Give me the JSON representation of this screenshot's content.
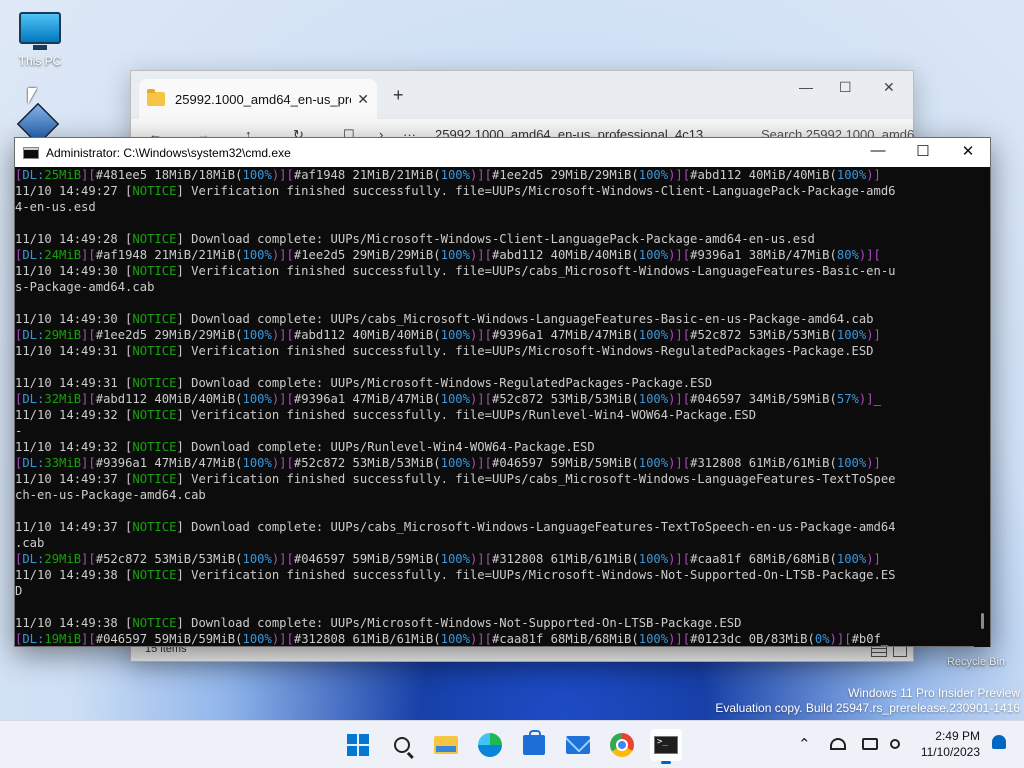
{
  "desktop": {
    "icons": [
      {
        "label": "This PC",
        "icon": "computer-icon"
      },
      {
        "label": "",
        "icon": "virtualbox-icon"
      },
      {
        "label": "Recycle Bin",
        "icon": "recycle-bin-icon"
      }
    ]
  },
  "explorer": {
    "tab_title": "25992.1000_amd64_en-us_pro",
    "tab_close": "✕",
    "new_tab": "+",
    "minimize": "—",
    "maximize": "☐",
    "close": "✕",
    "nav": {
      "back": "←",
      "forward": "→",
      "up": "↑",
      "refresh": "↻",
      "view": "☐",
      "chevron": "›",
      "more": "···"
    },
    "address": "25992.1000_amd64_en-us_professional_4c13...",
    "search_placeholder": "Search 25992.1000_amd6",
    "status": "15 items"
  },
  "cmd": {
    "title": "Administrator: C:\\Windows\\system32\\cmd.exe",
    "minimize": "—",
    "maximize": "☐",
    "close": "✕",
    "colors": {
      "magenta": "#b148c6",
      "cyan": "#3a96dd",
      "green": "#13a10e",
      "text": "#cccccc",
      "background": "#0c0c0c"
    },
    "lines": [
      [
        [
          "[",
          "m"
        ],
        [
          "DL:",
          "c"
        ],
        [
          "25MiB",
          "g"
        ],
        [
          "][",
          "m"
        ],
        [
          "#481ee5 18MiB/18MiB(",
          ""
        ],
        [
          "100%",
          "c"
        ],
        [
          ")][",
          "m"
        ],
        [
          "#af1948 21MiB/21MiB(",
          ""
        ],
        [
          "100%",
          "c"
        ],
        [
          ")][",
          "m"
        ],
        [
          "#1ee2d5 29MiB/29MiB(",
          ""
        ],
        [
          "100%",
          "c"
        ],
        [
          ")][",
          "m"
        ],
        [
          "#abd112 40MiB/40MiB(",
          ""
        ],
        [
          "100%",
          "c"
        ],
        [
          ")]",
          "m"
        ]
      ],
      [
        [
          "11/10 14:49:27 [",
          ""
        ],
        [
          "NOTICE",
          "g"
        ],
        [
          "] Verification finished successfully. file=UUPs/Microsoft-Windows-Client-LanguagePack-Package-amd6",
          ""
        ]
      ],
      [
        [
          "4-en-us.esd",
          ""
        ]
      ],
      [
        [
          "",
          ""
        ]
      ],
      [
        [
          "11/10 14:49:28 [",
          ""
        ],
        [
          "NOTICE",
          "g"
        ],
        [
          "] Download complete: UUPs/Microsoft-Windows-Client-LanguagePack-Package-amd64-en-us.esd",
          ""
        ]
      ],
      [
        [
          "[",
          "m"
        ],
        [
          "DL:",
          "c"
        ],
        [
          "24MiB",
          "g"
        ],
        [
          "][",
          "m"
        ],
        [
          "#af1948 21MiB/21MiB(",
          ""
        ],
        [
          "100%",
          "c"
        ],
        [
          ")][",
          "m"
        ],
        [
          "#1ee2d5 29MiB/29MiB(",
          ""
        ],
        [
          "100%",
          "c"
        ],
        [
          ")][",
          "m"
        ],
        [
          "#abd112 40MiB/40MiB(",
          ""
        ],
        [
          "100%",
          "c"
        ],
        [
          ")][",
          "m"
        ],
        [
          "#9396a1 38MiB/47MiB(",
          ""
        ],
        [
          "80%",
          "c"
        ],
        [
          ")][",
          "m"
        ]
      ],
      [
        [
          "11/10 14:49:30 [",
          ""
        ],
        [
          "NOTICE",
          "g"
        ],
        [
          "] Verification finished successfully. file=UUPs/cabs_Microsoft-Windows-LanguageFeatures-Basic-en-u",
          ""
        ]
      ],
      [
        [
          "s-Package-amd64.cab",
          ""
        ]
      ],
      [
        [
          "",
          ""
        ]
      ],
      [
        [
          "11/10 14:49:30 [",
          ""
        ],
        [
          "NOTICE",
          "g"
        ],
        [
          "] Download complete: UUPs/cabs_Microsoft-Windows-LanguageFeatures-Basic-en-us-Package-amd64.cab",
          ""
        ]
      ],
      [
        [
          "[",
          "m"
        ],
        [
          "DL:",
          "c"
        ],
        [
          "29MiB",
          "g"
        ],
        [
          "][",
          "m"
        ],
        [
          "#1ee2d5 29MiB/29MiB(",
          ""
        ],
        [
          "100%",
          "c"
        ],
        [
          ")][",
          "m"
        ],
        [
          "#abd112 40MiB/40MiB(",
          ""
        ],
        [
          "100%",
          "c"
        ],
        [
          ")][",
          "m"
        ],
        [
          "#9396a1 47MiB/47MiB(",
          ""
        ],
        [
          "100%",
          "c"
        ],
        [
          ")][",
          "m"
        ],
        [
          "#52c872 53MiB/53MiB(",
          ""
        ],
        [
          "100%",
          "c"
        ],
        [
          ")]",
          "m"
        ]
      ],
      [
        [
          "11/10 14:49:31 [",
          ""
        ],
        [
          "NOTICE",
          "g"
        ],
        [
          "] Verification finished successfully. file=UUPs/Microsoft-Windows-RegulatedPackages-Package.ESD",
          ""
        ]
      ],
      [
        [
          "",
          ""
        ]
      ],
      [
        [
          "11/10 14:49:31 [",
          ""
        ],
        [
          "NOTICE",
          "g"
        ],
        [
          "] Download complete: UUPs/Microsoft-Windows-RegulatedPackages-Package.ESD",
          ""
        ]
      ],
      [
        [
          "[",
          "m"
        ],
        [
          "DL:",
          "c"
        ],
        [
          "32MiB",
          "g"
        ],
        [
          "][",
          "m"
        ],
        [
          "#abd112 40MiB/40MiB(",
          ""
        ],
        [
          "100%",
          "c"
        ],
        [
          ")][",
          "m"
        ],
        [
          "#9396a1 47MiB/47MiB(",
          ""
        ],
        [
          "100%",
          "c"
        ],
        [
          ")][",
          "m"
        ],
        [
          "#52c872 53MiB/53MiB(",
          ""
        ],
        [
          "100%",
          "c"
        ],
        [
          ")][",
          "m"
        ],
        [
          "#046597 34MiB/59MiB(",
          ""
        ],
        [
          "57%",
          "c"
        ],
        [
          ")]",
          "m"
        ],
        [
          "_",
          ""
        ]
      ],
      [
        [
          "11/10 14:49:32 [",
          ""
        ],
        [
          "NOTICE",
          "g"
        ],
        [
          "] Verification finished successfully. file=UUPs/Runlevel-Win4-WOW64-Package.ESD",
          ""
        ]
      ],
      [
        [
          "-",
          ""
        ]
      ],
      [
        [
          "11/10 14:49:32 [",
          ""
        ],
        [
          "NOTICE",
          "g"
        ],
        [
          "] Download complete: UUPs/Runlevel-Win4-WOW64-Package.ESD",
          ""
        ]
      ],
      [
        [
          "[",
          "m"
        ],
        [
          "DL:",
          "c"
        ],
        [
          "33MiB",
          "g"
        ],
        [
          "][",
          "m"
        ],
        [
          "#9396a1 47MiB/47MiB(",
          ""
        ],
        [
          "100%",
          "c"
        ],
        [
          ")][",
          "m"
        ],
        [
          "#52c872 53MiB/53MiB(",
          ""
        ],
        [
          "100%",
          "c"
        ],
        [
          ")][",
          "m"
        ],
        [
          "#046597 59MiB/59MiB(",
          ""
        ],
        [
          "100%",
          "c"
        ],
        [
          ")][",
          "m"
        ],
        [
          "#312808 61MiB/61MiB(",
          ""
        ],
        [
          "100%",
          "c"
        ],
        [
          ")]",
          "m"
        ]
      ],
      [
        [
          "11/10 14:49:37 [",
          ""
        ],
        [
          "NOTICE",
          "g"
        ],
        [
          "] Verification finished successfully. file=UUPs/cabs_Microsoft-Windows-LanguageFeatures-TextToSpee",
          ""
        ]
      ],
      [
        [
          "ch-en-us-Package-amd64.cab",
          ""
        ]
      ],
      [
        [
          "",
          ""
        ]
      ],
      [
        [
          "11/10 14:49:37 [",
          ""
        ],
        [
          "NOTICE",
          "g"
        ],
        [
          "] Download complete: UUPs/cabs_Microsoft-Windows-LanguageFeatures-TextToSpeech-en-us-Package-amd64",
          ""
        ]
      ],
      [
        [
          ".cab",
          ""
        ]
      ],
      [
        [
          "[",
          "m"
        ],
        [
          "DL:",
          "c"
        ],
        [
          "29MiB",
          "g"
        ],
        [
          "][",
          "m"
        ],
        [
          "#52c872 53MiB/53MiB(",
          ""
        ],
        [
          "100%",
          "c"
        ],
        [
          ")][",
          "m"
        ],
        [
          "#046597 59MiB/59MiB(",
          ""
        ],
        [
          "100%",
          "c"
        ],
        [
          ")][",
          "m"
        ],
        [
          "#312808 61MiB/61MiB(",
          ""
        ],
        [
          "100%",
          "c"
        ],
        [
          ")][",
          "m"
        ],
        [
          "#caa81f 68MiB/68MiB(",
          ""
        ],
        [
          "100%",
          "c"
        ],
        [
          ")]",
          "m"
        ]
      ],
      [
        [
          "11/10 14:49:38 [",
          ""
        ],
        [
          "NOTICE",
          "g"
        ],
        [
          "] Verification finished successfully. file=UUPs/Microsoft-Windows-Not-Supported-On-LTSB-Package.ES",
          ""
        ]
      ],
      [
        [
          "D",
          ""
        ]
      ],
      [
        [
          "",
          ""
        ]
      ],
      [
        [
          "11/10 14:49:38 [",
          ""
        ],
        [
          "NOTICE",
          "g"
        ],
        [
          "] Download complete: UUPs/Microsoft-Windows-Not-Supported-On-LTSB-Package.ESD",
          ""
        ]
      ],
      [
        [
          "[",
          "m"
        ],
        [
          "DL:",
          "c"
        ],
        [
          "19MiB",
          "g"
        ],
        [
          "][",
          "m"
        ],
        [
          "#046597 59MiB/59MiB(",
          ""
        ],
        [
          "100%",
          "c"
        ],
        [
          ")][",
          "m"
        ],
        [
          "#312808 61MiB/61MiB(",
          ""
        ],
        [
          "100%",
          "c"
        ],
        [
          ")][",
          "m"
        ],
        [
          "#caa81f 68MiB/68MiB(",
          ""
        ],
        [
          "100%",
          "c"
        ],
        [
          ")][",
          "m"
        ],
        [
          "#0123dc 0B/83MiB(",
          ""
        ],
        [
          "0%",
          "c"
        ],
        [
          ")][",
          "m"
        ],
        [
          "#b0f",
          ""
        ],
        [
          "_",
          ""
        ]
      ]
    ]
  },
  "watermark": {
    "line1": "Windows 11 Pro Insider Preview",
    "line2": "Evaluation copy. Build 25947.rs_prerelease.230901-1416"
  },
  "taskbar": {
    "apps": [
      "windows-start",
      "search",
      "file-explorer",
      "edge",
      "microsoft-store",
      "mail",
      "chrome",
      "command-prompt"
    ],
    "tray": {
      "chevron": "⌃",
      "time": "2:49 PM",
      "date": "11/10/2023"
    }
  }
}
